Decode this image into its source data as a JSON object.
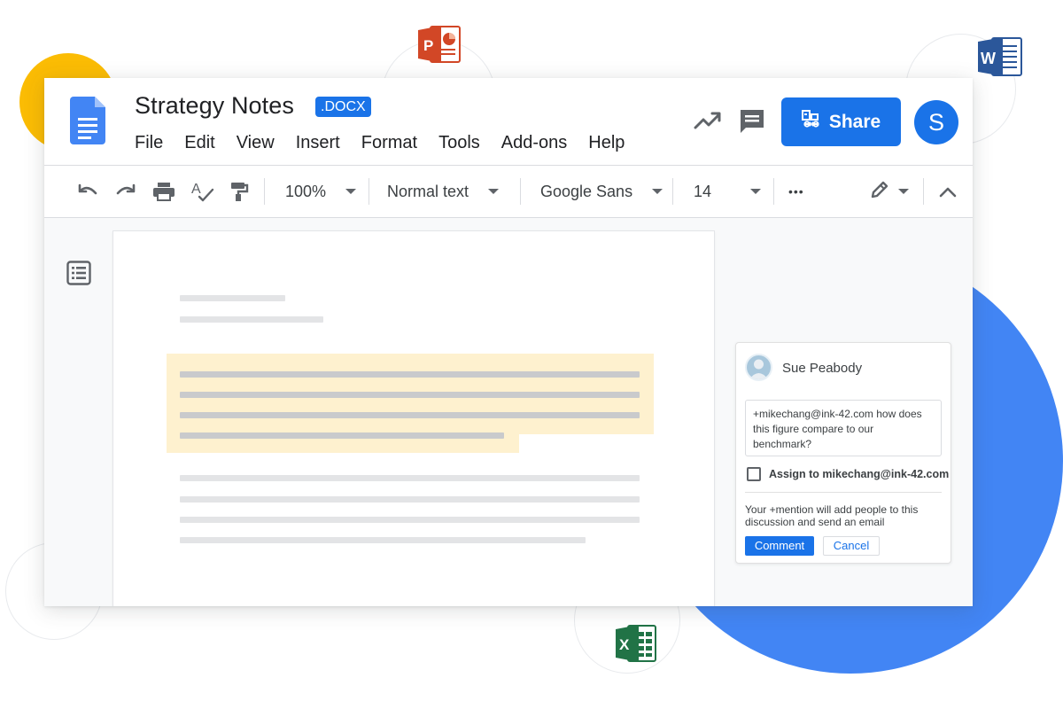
{
  "document": {
    "title": "Strategy Notes",
    "format_badge": ".DOCX"
  },
  "menu": [
    "File",
    "Edit",
    "View",
    "Insert",
    "Format",
    "Tools",
    "Add-ons",
    "Help"
  ],
  "header": {
    "share_label": "Share",
    "avatar_initial": "S",
    "activity_icon": "trending-up-icon",
    "comments_icon": "comment-icon"
  },
  "toolbar": {
    "zoom": "100%",
    "style": "Normal text",
    "font": "Google Sans",
    "font_size": "14",
    "more": "•••",
    "icons": [
      "undo-icon",
      "redo-icon",
      "print-icon",
      "spellcheck-icon",
      "paint-format-icon",
      "edit-mode-icon",
      "collapse-icon"
    ]
  },
  "comment": {
    "author": "Sue Peabody",
    "text": "+mikechang@ink-42.com how does this figure compare to our benchmark?",
    "assign_label": "Assign to mikechang@ink-42.com",
    "note": "Your +mention will add people to this discussion and send an email",
    "comment_button": "Comment",
    "cancel_button": "Cancel"
  },
  "colors": {
    "accent": "#1a73e8",
    "highlight": "#fef1cf",
    "bg_blue": "#4285f4",
    "bg_yellow": "#fbbc04"
  },
  "app_logos": [
    "powerpoint-logo",
    "word-logo",
    "excel-logo"
  ]
}
